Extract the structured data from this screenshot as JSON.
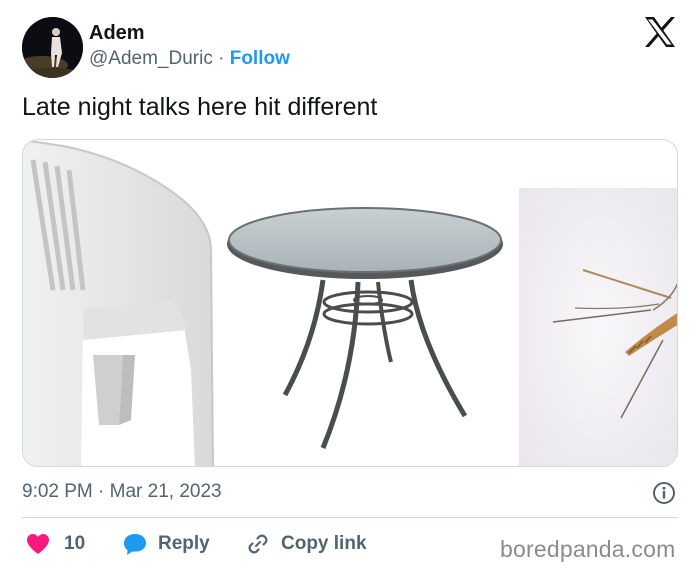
{
  "author": {
    "name": "Adem",
    "handle": "@Adem_Duric",
    "separator": "·",
    "follow_label": "Follow"
  },
  "tweet": {
    "text": "Late night talks here hit different",
    "images": [
      {
        "subject": "white plastic chair"
      },
      {
        "subject": "round glass patio table"
      },
      {
        "subject": "mosquito"
      }
    ],
    "timestamp": "9:02 PM · Mar 21, 2023"
  },
  "actions": {
    "like_count": "10",
    "reply_label": "Reply",
    "copy_label": "Copy link"
  },
  "icons": {
    "logo": "x-logo-icon",
    "info": "info-icon",
    "like": "heart-icon",
    "reply": "speech-bubble-icon",
    "copy": "link-icon"
  },
  "watermark": "boredpanda.com",
  "colors": {
    "accent": "#1d9bf0",
    "like": "#f91880",
    "text": "#0f1419",
    "secondary": "#536471"
  }
}
